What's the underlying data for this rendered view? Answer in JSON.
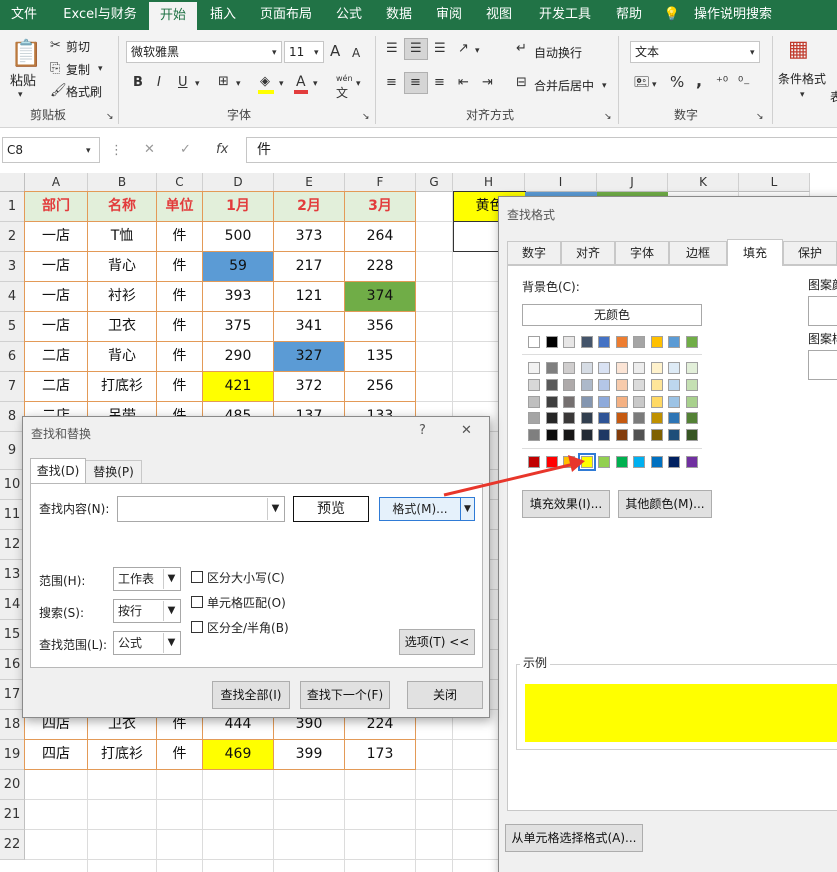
{
  "ribbon": {
    "tabs": [
      "文件",
      "Excel与财务",
      "开始",
      "插入",
      "页面布局",
      "公式",
      "数据",
      "审阅",
      "视图",
      "开发工具",
      "帮助",
      "操作说明搜索"
    ],
    "clipboard": {
      "paste": "粘贴",
      "cut": "剪切",
      "copy": "复制",
      "painter": "格式刷",
      "label": "剪贴板"
    },
    "font": {
      "name": "微软雅黑",
      "size": "11",
      "grow": "A",
      "shrink": "A",
      "bold": "B",
      "italic": "I",
      "underline": "U",
      "label": "字体",
      "wen": "wén",
      "wen_char": "文"
    },
    "align": {
      "wrap": "自动换行",
      "merge": "合并后居中",
      "label": "对齐方式"
    },
    "number": {
      "format": "文本",
      "label": "数字",
      "pct": "%",
      "comma": ","
    },
    "styles": {
      "cond": "条件格式",
      "cut_text": "表"
    }
  },
  "formula_bar": {
    "cell_ref": "C8",
    "cancel": "✕",
    "enter": "✓",
    "fx": "fx",
    "value": "件"
  },
  "columns": [
    "A",
    "B",
    "C",
    "D",
    "E",
    "F",
    "G",
    "H",
    "I",
    "J",
    "K",
    "L"
  ],
  "rows": [
    "1",
    "2",
    "3",
    "4",
    "5",
    "6",
    "7",
    "8",
    "9",
    "10",
    "11",
    "12",
    "13",
    "14",
    "15",
    "16",
    "17",
    "18",
    "19",
    "20",
    "21",
    "22"
  ],
  "table": {
    "headers": [
      "部门",
      "名称",
      "单位",
      "1月",
      "2月",
      "3月"
    ],
    "rows": [
      [
        "一店",
        "T恤",
        "件",
        "500",
        "373",
        "264"
      ],
      [
        "一店",
        "背心",
        "件",
        "59",
        "217",
        "228"
      ],
      [
        "一店",
        "衬衫",
        "件",
        "393",
        "121",
        "374"
      ],
      [
        "一店",
        "卫衣",
        "件",
        "375",
        "341",
        "356"
      ],
      [
        "二店",
        "背心",
        "件",
        "290",
        "327",
        "135"
      ],
      [
        "二店",
        "打底衫",
        "件",
        "421",
        "372",
        "256"
      ],
      [
        "二店",
        "吊带",
        "件",
        "485",
        "137",
        "133"
      ],
      [
        "四店",
        "卫衣",
        "件",
        "444",
        "390",
        "224"
      ],
      [
        "四店",
        "打底衫",
        "件",
        "469",
        "399",
        "173"
      ]
    ],
    "h1_text": "黄色"
  },
  "colors": {
    "yellow": "#ffff00",
    "blue": "#5b9bd5",
    "green": "#70ad47",
    "accent": "#217346",
    "arrow": "#e8362b"
  },
  "find_dialog": {
    "title": "查找和替换",
    "help": "?",
    "close": "✕",
    "tabs": [
      "查找(D)",
      "替换(P)"
    ],
    "find_label": "查找内容(N):",
    "preview": "预览",
    "format_btn": "格式(M)...",
    "scope_label": "范围(H):",
    "scope_value": "工作表",
    "search_label": "搜索(S):",
    "search_value": "按行",
    "lookin_label": "查找范围(L):",
    "lookin_value": "公式",
    "opt_case": "区分大小写(C)",
    "opt_cell": "单元格匹配(O)",
    "opt_width": "区分全/半角(B)",
    "options_btn": "选项(T) <<",
    "find_all": "查找全部(I)",
    "find_next": "查找下一个(F)",
    "close_btn": "关闭"
  },
  "format_dialog": {
    "title": "查找格式",
    "tabs": [
      "数字",
      "对齐",
      "字体",
      "边框",
      "填充",
      "保护"
    ],
    "bg_label": "背景色(C):",
    "no_color": "无颜色",
    "pattern_color": "图案颜",
    "pattern_style": "图案样",
    "fill_effects": "填充效果(I)...",
    "more_colors": "其他颜色(M)...",
    "sample_label": "示例",
    "sample_color": "#ffff00",
    "from_cell": "从单元格选择格式(A)...",
    "theme_top": [
      "#ffffff",
      "#000000",
      "#e7e6e6",
      "#44546a",
      "#4472c4",
      "#ed7d31",
      "#a5a5a5",
      "#ffc000",
      "#5b9bd5",
      "#70ad47"
    ],
    "theme_shades": [
      [
        "#f2f2f2",
        "#7f7f7f",
        "#d0cece",
        "#d6dce4",
        "#d9e2f3",
        "#fbe4d5",
        "#ededed",
        "#fff2cc",
        "#deebf6",
        "#e2efd9"
      ],
      [
        "#d8d8d8",
        "#595959",
        "#aeaaaa",
        "#adb9ca",
        "#b4c6e7",
        "#f7cbac",
        "#dbdbdb",
        "#fee599",
        "#bdd7ee",
        "#c5e0b3"
      ],
      [
        "#bfbfbf",
        "#3f3f3f",
        "#757070",
        "#8496b0",
        "#8eaadb",
        "#f4b183",
        "#c9c9c9",
        "#ffd965",
        "#9cc3e5",
        "#a8d08d"
      ],
      [
        "#a5a5a5",
        "#262626",
        "#3a3838",
        "#323f4f",
        "#2f5496",
        "#c55a11",
        "#7b7b7b",
        "#bf9000",
        "#2e75b5",
        "#538135"
      ],
      [
        "#7f7f7f",
        "#0c0c0c",
        "#171616",
        "#222a35",
        "#1f3864",
        "#833c0b",
        "#525252",
        "#7f6000",
        "#1e4e79",
        "#375623"
      ]
    ],
    "standard": [
      "#c00000",
      "#ff0000",
      "#ffc000",
      "#ffff00",
      "#92d050",
      "#00b050",
      "#00b0f0",
      "#0070c0",
      "#002060",
      "#7030a0"
    ]
  }
}
